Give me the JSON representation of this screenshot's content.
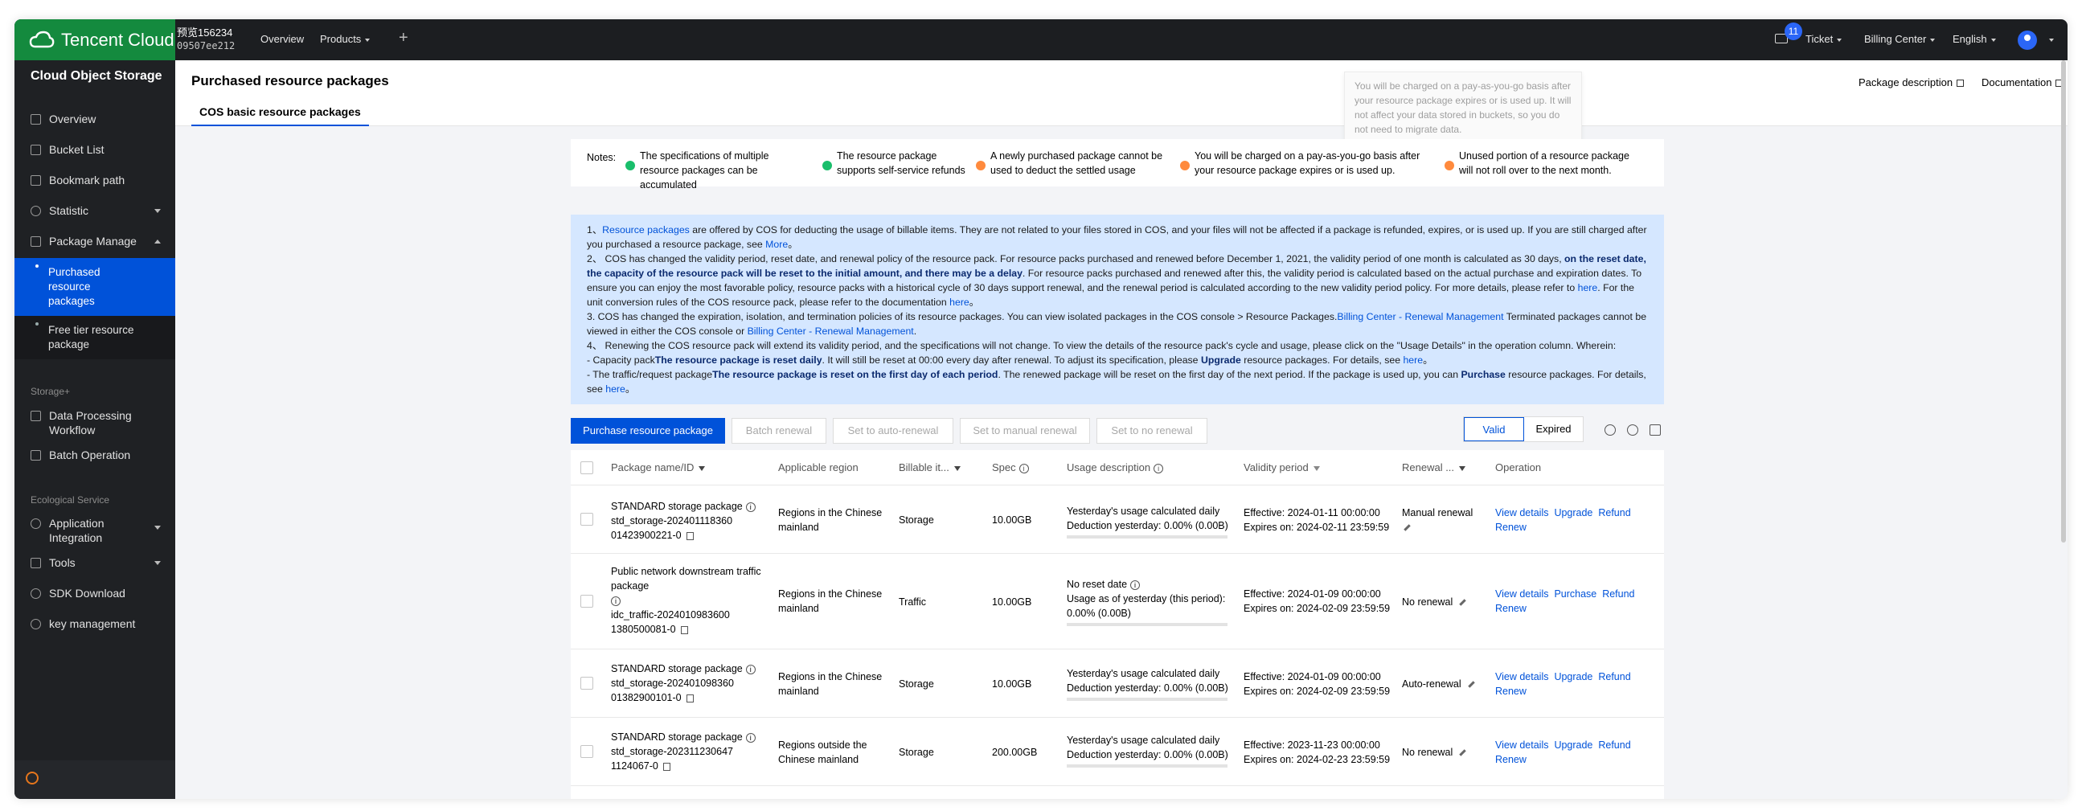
{
  "topnav": {
    "brand": "Tencent Cloud",
    "account_name": "预览156234",
    "account_id": "09507ee212",
    "overview": "Overview",
    "products": "Products",
    "plus": "+",
    "mail_count": "11",
    "ticket": "Ticket",
    "billing": "Billing Center",
    "language": "English"
  },
  "sidebar": {
    "title": "Cloud Object Storage",
    "items": {
      "overview": "Overview",
      "bucket_list": "Bucket List",
      "bookmark": "Bookmark path",
      "statistic": "Statistic",
      "package_manage": "Package Manage",
      "purchased": "Purchased resource packages",
      "free_tier": "Free tier resource package",
      "data_processing": "Data Processing Workflow",
      "batch_operation": "Batch Operation",
      "app_integration": "Application Integration",
      "tools": "Tools",
      "sdk_download": "SDK Download",
      "key_management": "key management"
    },
    "sections": {
      "storage_plus": "Storage+",
      "ecological": "Ecological Service"
    }
  },
  "header": {
    "title": "Purchased resource packages",
    "tab": "COS basic resource packages",
    "package_description": "Package description",
    "documentation": "Documentation",
    "tooltip": "You will be charged on a pay-as-you-go basis after your resource package expires or is used up. It will not affect your data stored in buckets, so you do not need to migrate data."
  },
  "notes": {
    "label": "Notes:",
    "items": [
      {
        "text": "The specifications of multiple resource packages can be accumulated",
        "icon": "check-icon"
      },
      {
        "text": "The resource package supports self-service refunds",
        "icon": "check-icon"
      },
      {
        "text": "A newly purchased package cannot be used to deduct the settled usage",
        "icon": "warning-icon"
      },
      {
        "text": "You will be charged on a pay-as-you-go basis after your resource package expires or is used up.",
        "icon": "warning-icon"
      },
      {
        "text": "Unused portion of a resource package will not roll over to the next month.",
        "icon": "warning-icon"
      }
    ]
  },
  "info": {
    "p1a": "1、",
    "p1_link": "Resource packages",
    "p1b": " are offered by COS for deducting the usage of billable items. They are not related to your files stored in COS, and your files will not be affected if a package is refunded, expires, or is used up. If you are still charged after you purchased a resource package, see ",
    "p1_more": "More",
    "p1c": "。",
    "p2a": "2、 COS has changed the validity period, reset date, and renewal policy of the resource pack. For resource packs purchased and renewed before December 1, 2021, the validity period of one month is calculated as 30 days,  ",
    "p2_bold": "on the reset date, the capacity of the resource pack will be reset to the initial amount, and there may be a delay",
    "p2b": ". For resource packs purchased and renewed after this, the validity period is calculated based on the actual purchase and expiration dates. To ensure you can enjoy the most favorable policy, resource packs with a historical cycle of 30 days support renewal, and the renewal period is calculated according to the new validity period policy. For more details, please refer to ",
    "p2_here": "here",
    "p2c": ". For the unit conversion rules of the COS resource pack, please refer to the documentation ",
    "p2_here2": "here",
    "p2d": "。",
    "p3a": "3. COS has changed the expiration, isolation, and termination policies of its resource packages. You can view isolated packages in the COS console > Resource Packages.",
    "p3_link": "Billing Center - Renewal Management",
    "p3b": " Terminated packages cannot be viewed in either the COS console or ",
    "p3_link2": "Billing Center - Renewal Management",
    "p3c": ".",
    "p4": "4、 Renewing the COS resource pack will extend its validity period, and the specifications will not change. To view the details of the resource pack's cycle and usage, please click on the \"Usage Details\" in the operation column. Wherein:",
    "p5a": "- Capacity pack",
    "p5_bold": "The resource package is reset daily",
    "p5b": ". It will still be reset at 00:00 every day after renewal. To adjust its specification, please ",
    "p5_upgrade": "Upgrade",
    "p5c": " resource packages. For details, see ",
    "p5_here": "here",
    "p5d": "。",
    "p6a": "- The traffic/request package",
    "p6_bold": "The resource package is reset on the first day of each period",
    "p6b": ". The renewed package will be reset on the first day of the next period. If the package is used up, you can ",
    "p6_purchase": "Purchase",
    "p6c": " resource packages. For details, see ",
    "p6_here": "here",
    "p6d": "。"
  },
  "toolbar": {
    "purchase": "Purchase resource package",
    "batch_renewal": "Batch renewal",
    "auto_renewal": "Set to auto-renewal",
    "manual_renewal": "Set to manual renewal",
    "no_renewal": "Set to no renewal",
    "valid": "Valid",
    "expired": "Expired"
  },
  "table": {
    "columns": {
      "name": "Package name/ID",
      "region": "Applicable region",
      "billable": "Billable it...",
      "spec": "Spec",
      "usage": "Usage description",
      "validity": "Validity period",
      "renewal": "Renewal ...",
      "operation": "Operation"
    },
    "rows": [
      {
        "name": "STANDARD storage package",
        "id1": "std_storage-202401118360",
        "id2": "01423900221-0",
        "region": "Regions in the Chinese mainland",
        "billable": "Storage",
        "spec": "10.00GB",
        "usage1": "Yesterday's usage calculated daily",
        "usage2": "Deduction yesterday: 0.00% (0.00B)",
        "usage_pct": 0,
        "effective": "Effective: 2024-01-11 00:00:00",
        "expires": "Expires on: 2024-02-11 23:59:59",
        "renewal": "Manual renewal",
        "op1": "View details",
        "op2": "Upgrade",
        "op3": "Refund",
        "op4": "Renew"
      },
      {
        "name": "Public network downstream traffic package",
        "id1": "idc_traffic-2024010983600",
        "id2": "1380500081-0",
        "region": "Regions in the Chinese mainland",
        "billable": "Traffic",
        "spec": "10.00GB",
        "usage1": "No reset date",
        "usage2": "Usage as of yesterday (this period): 0.00%  (0.00B)",
        "usage_pct": 0,
        "effective": "Effective: 2024-01-09 00:00:00",
        "expires": "Expires on: 2024-02-09 23:59:59",
        "renewal": "No renewal",
        "op1": "View details",
        "op2": "Purchase",
        "op3": "Refund",
        "op4": "Renew"
      },
      {
        "name": "STANDARD storage package",
        "id1": "std_storage-202401098360",
        "id2": "01382900101-0",
        "region": "Regions in the Chinese mainland",
        "billable": "Storage",
        "spec": "10.00GB",
        "usage1": "Yesterday's usage calculated daily",
        "usage2": "Deduction yesterday: 0.00% (0.00B)",
        "usage_pct": 0,
        "effective": "Effective: 2024-01-09 00:00:00",
        "expires": "Expires on: 2024-02-09 23:59:59",
        "renewal": "Auto-renewal",
        "op1": "View details",
        "op2": "Upgrade",
        "op3": "Refund",
        "op4": "Renew"
      },
      {
        "name": "STANDARD storage package",
        "id1": "std_storage-202311230647",
        "id2": "1124067-0",
        "region": "Regions outside the Chinese mainland",
        "billable": "Storage",
        "spec": "200.00GB",
        "usage1": "Yesterday's usage calculated daily",
        "usage2": "Deduction yesterday: 0.00% (0.00B)",
        "usage_pct": 0,
        "effective": "Effective: 2023-11-23 00:00:00",
        "expires": "Expires on: 2024-02-23 23:59:59",
        "renewal": "No renewal",
        "op1": "View details",
        "op2": "Upgrade",
        "op3": "Refund",
        "op4": "Renew"
      }
    ]
  }
}
